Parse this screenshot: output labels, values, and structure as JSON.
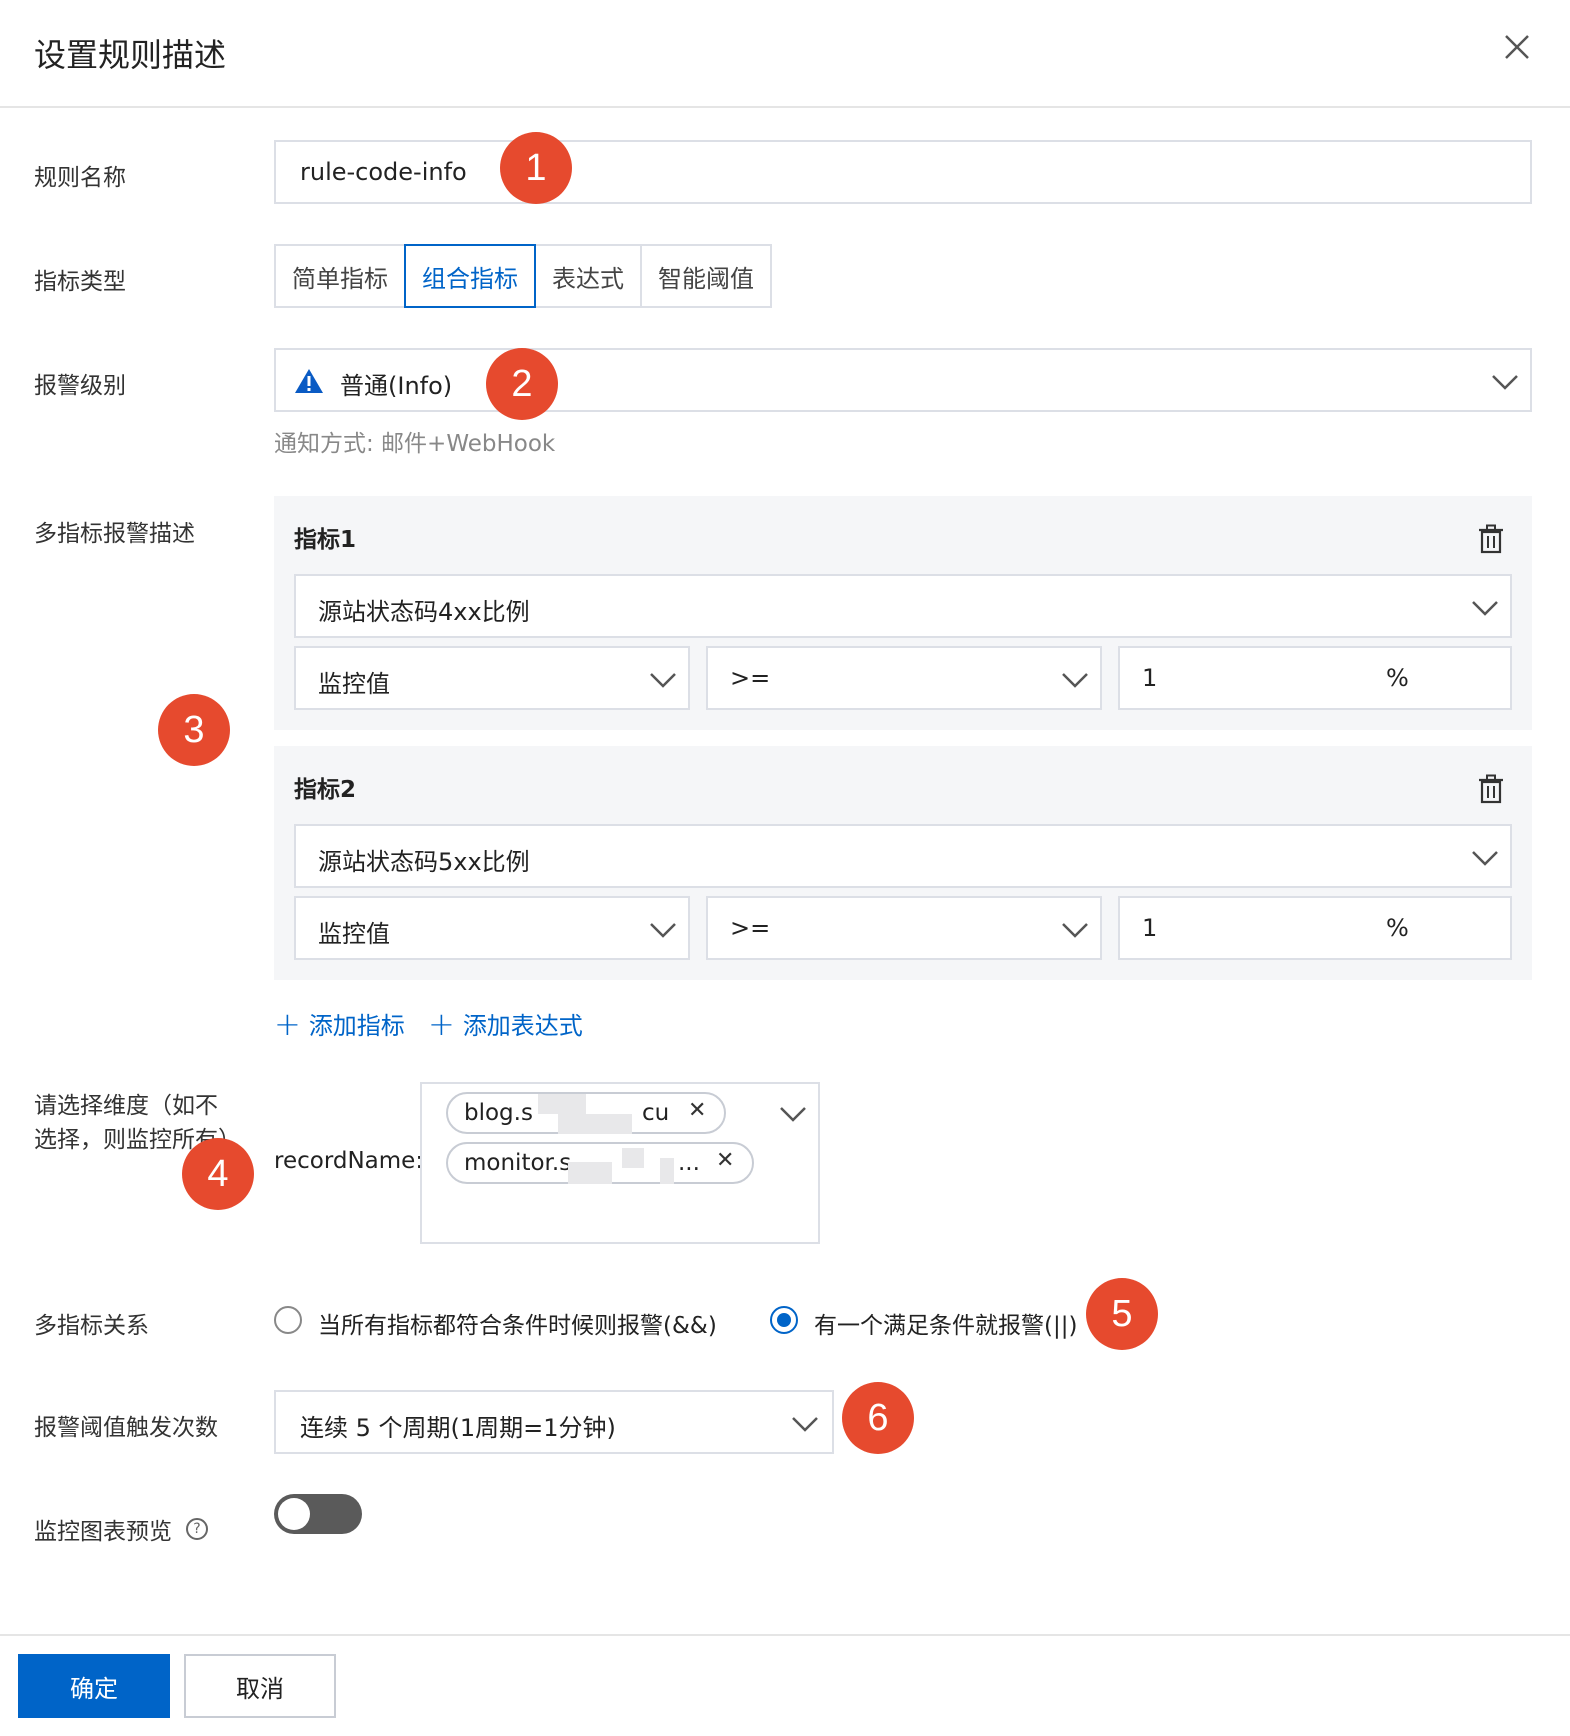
{
  "dialog": {
    "title": "设置规则描述"
  },
  "rule_name": {
    "label": "规则名称",
    "value": "rule-code-info"
  },
  "metric_type": {
    "label": "指标类型",
    "options": [
      "简单指标",
      "组合指标",
      "表达式",
      "智能阈值"
    ],
    "selected": "组合指标"
  },
  "alert_level": {
    "label": "报警级别",
    "value": "普通(Info)",
    "hint": "通知方式: 邮件+WebHook"
  },
  "multi_metric": {
    "label": "多指标报警描述",
    "metrics": [
      {
        "title": "指标1",
        "metric": "源站状态码4xx比例",
        "stat": "监控值",
        "operator": ">=",
        "threshold": "1",
        "unit": "%"
      },
      {
        "title": "指标2",
        "metric": "源站状态码5xx比例",
        "stat": "监控值",
        "operator": ">=",
        "threshold": "1",
        "unit": "%"
      }
    ],
    "add_metric": "添加指标",
    "add_expression": "添加表达式"
  },
  "dimension": {
    "label_line1": "请选择维度（如不",
    "label_line2": "选择，则监控所有）",
    "field_label": "recordName:",
    "tags": [
      {
        "prefix": "blog.s",
        "suffix": "cu"
      },
      {
        "prefix": "monitor.s",
        "suffix": "..."
      }
    ]
  },
  "relation": {
    "label": "多指标关系",
    "options": [
      "当所有指标都符合条件时候则报警(&&)",
      "有一个满足条件就报警(||)"
    ],
    "selected_index": 1
  },
  "trigger": {
    "label": "报警阈值触发次数",
    "value": "连续 5 个周期(1周期=1分钟)"
  },
  "preview": {
    "label": "监控图表预览",
    "enabled": false
  },
  "footer": {
    "confirm": "确定",
    "cancel": "取消"
  },
  "annotations": [
    "1",
    "2",
    "3",
    "4",
    "5",
    "6"
  ],
  "colors": {
    "primary": "#0064c8",
    "badge": "#e64a2e",
    "warning": "#0a5bc4"
  },
  "icons": [
    "close-icon",
    "warning-triangle-icon",
    "chevron-down-icon",
    "trash-icon",
    "plus-icon",
    "help-circle-icon"
  ]
}
